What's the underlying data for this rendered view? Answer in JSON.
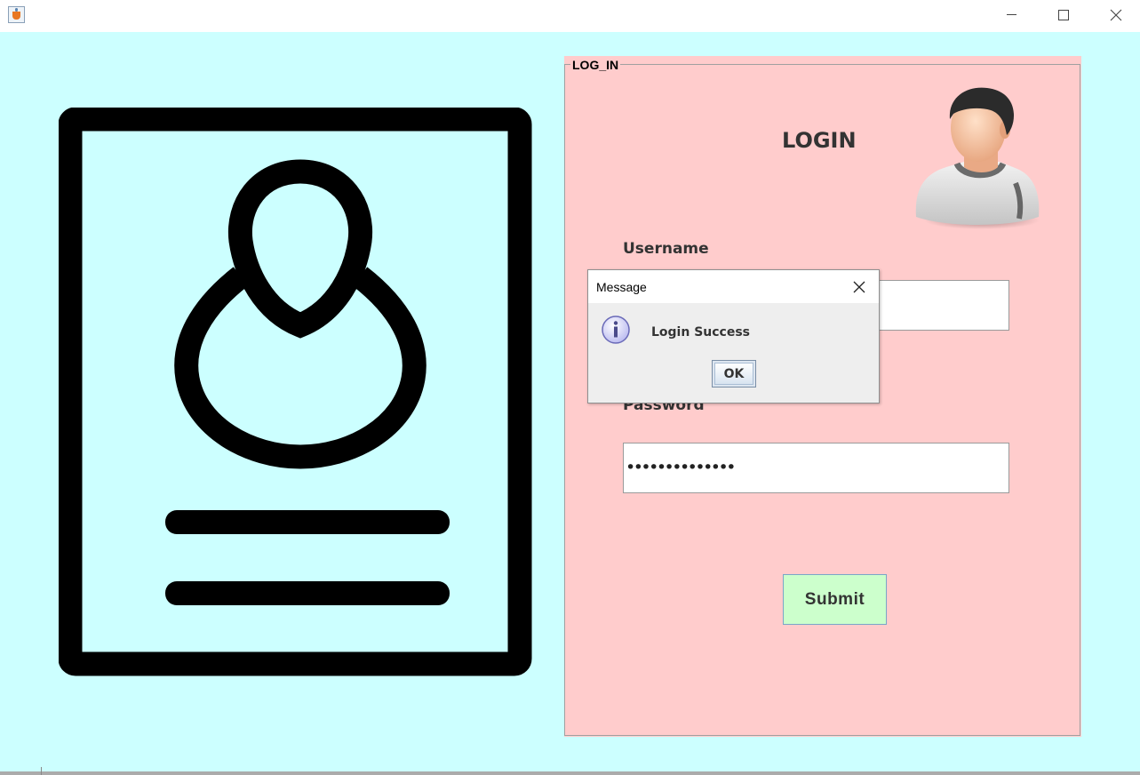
{
  "window": {
    "title": "",
    "icon": "java-cup-icon",
    "controls": [
      "minimize-icon",
      "maximize-icon",
      "close-icon"
    ]
  },
  "illustration": {
    "icon": "id-card-person-icon"
  },
  "panel": {
    "legend": "LOG_IN",
    "title": "LOGIN",
    "avatar_icon": "user-avatar-icon",
    "username_label": "Username",
    "username_value": "",
    "password_label": "Password",
    "password_value": "••••••••••••••",
    "submit_label": "Submit",
    "background_color": "#ffcccc",
    "submit_color": "#ccffcc"
  },
  "dialog": {
    "title": "Message",
    "message": "Login Success",
    "ok_label": "OK",
    "icon": "info-icon"
  },
  "colors": {
    "client_background": "#ccffff"
  }
}
